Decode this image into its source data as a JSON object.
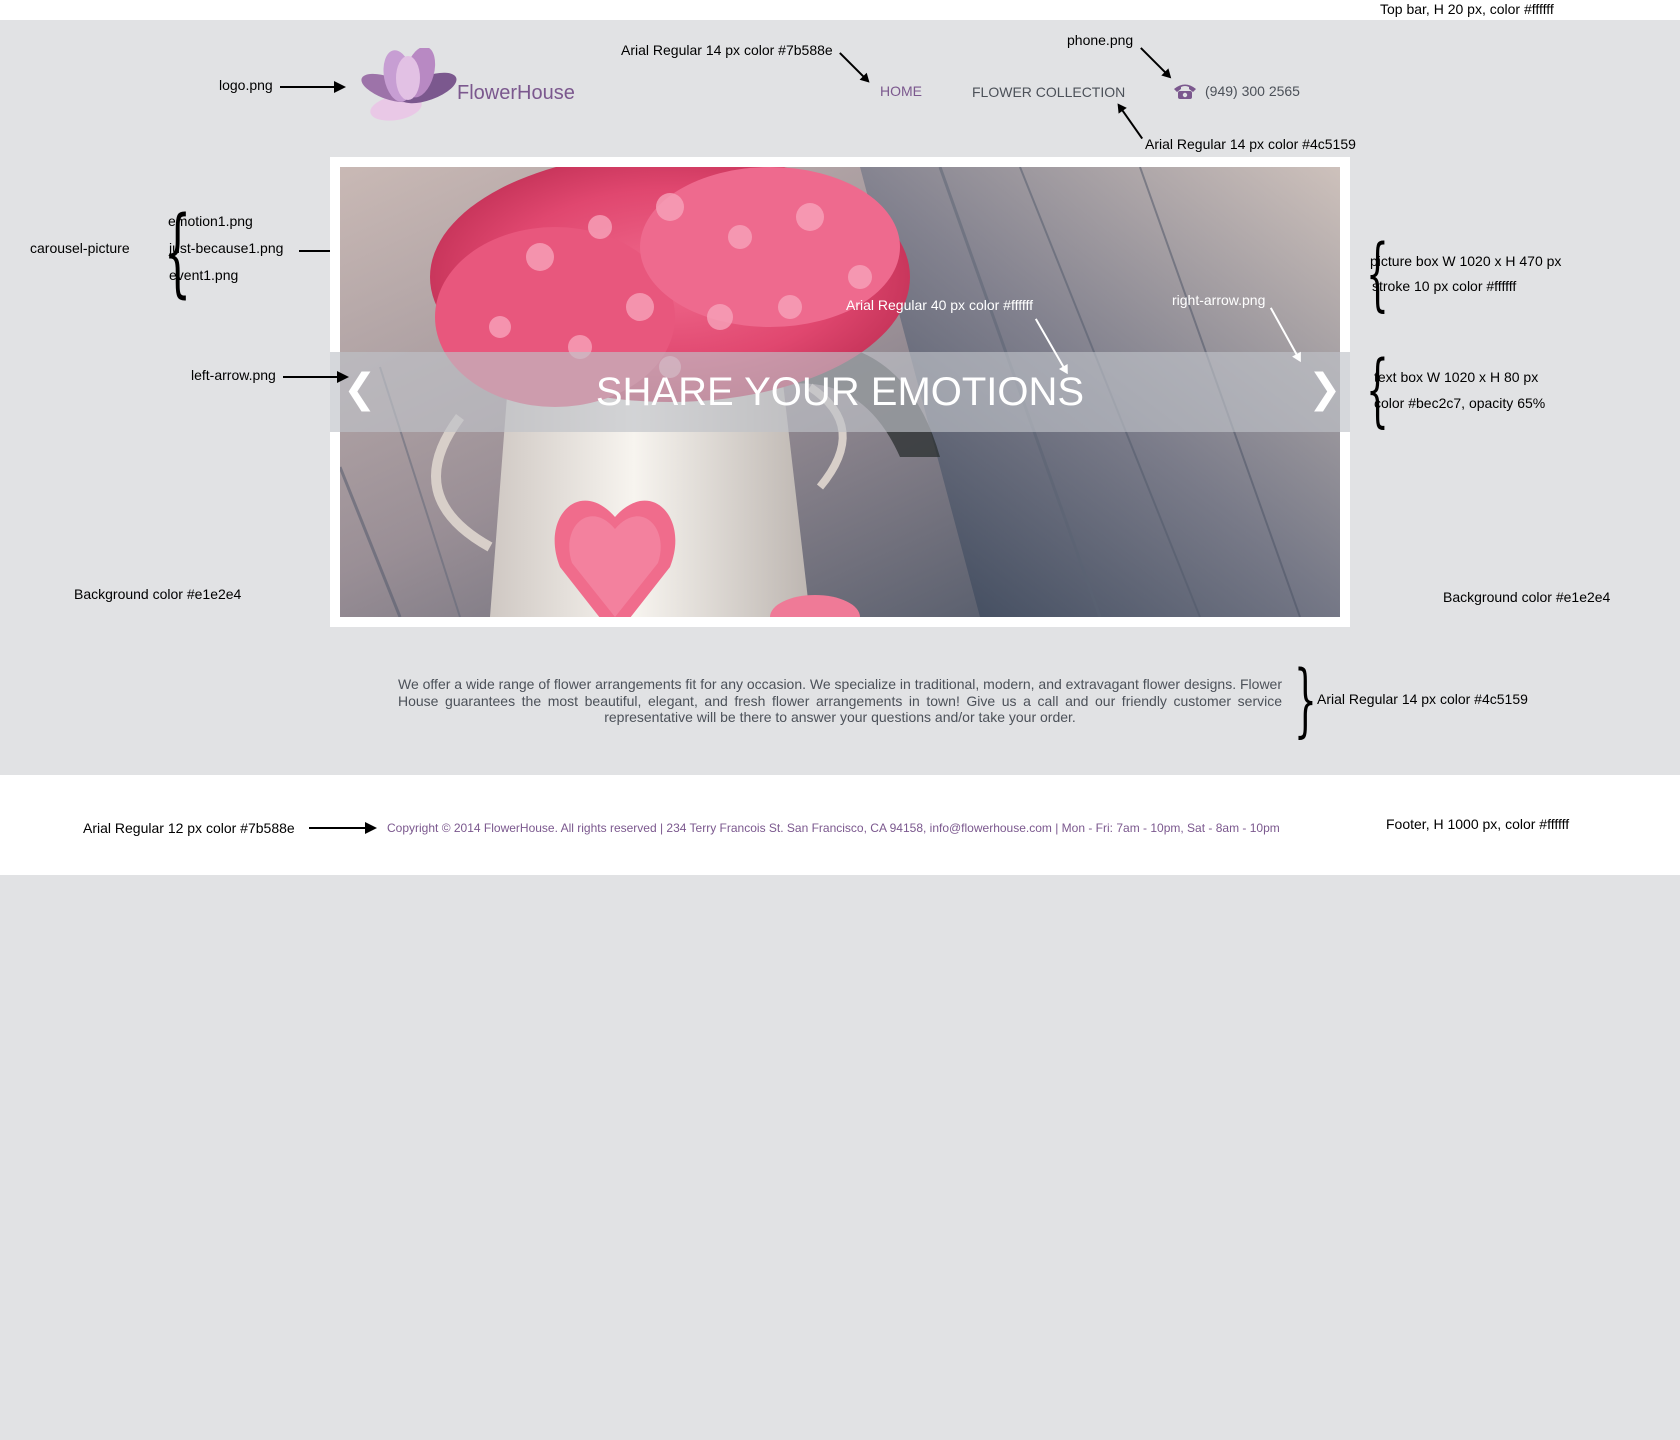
{
  "brand": {
    "name": "FlowerHouse"
  },
  "nav": {
    "home": "HOME",
    "collection": "FLOWER COLLECTION",
    "phone": "(949) 300 2565"
  },
  "hero": {
    "headline": "SHARE YOUR EMOTIONS",
    "left_arrow": "❮",
    "right_arrow": "❯"
  },
  "description": "We offer a wide range of flower arrangements fit for any occasion. We specialize in traditional, modern, and extravagant flower designs. Flower House guarantees the most beautiful, elegant, and fresh flower arrangements in town! Give us a call and our friendly customer service representative will be there to answer your questions and/or take your order.",
  "footer": {
    "text": "Copyright © 2014 FlowerHouse. All rights reserved  |  234 Terry Francois St. San Francisco, CA 94158, info@flowerhouse.com  |  Mon - Fri: 7am - 10pm, Sat - 8am - 10pm"
  },
  "annotations": {
    "top_bar": "Top bar, H 20 px, color #ffffff",
    "logo": "logo.png",
    "nav_home_font": "Arial Regular 14 px color #7b588e",
    "phone_icon": "phone.png",
    "nav_collection_font": "Arial Regular 14 px color #4c5159",
    "carousel_label": "carousel-picture",
    "carousel_files": [
      "emotion1.png",
      "just-because1.png",
      "event1.png"
    ],
    "hero_font": "Arial Regular 40 px color #ffffff",
    "right_arrow": "right-arrow.png",
    "picture_box": [
      "picture box W 1020 x H 470 px",
      "stroke 10 px color #ffffff"
    ],
    "left_arrow": "left-arrow.png",
    "text_box": [
      "text box W 1020 x H 80 px",
      "color #bec2c7, opacity 65%"
    ],
    "bg_left": "Background color #e1e2e4",
    "bg_right": "Background color #e1e2e4",
    "description_font": "Arial Regular 14 px color #4c5159",
    "footer_font": "Arial Regular 12 px color #7b588e",
    "footer_spec": "Footer, H 1000 px, color #ffffff"
  },
  "colors": {
    "accent": "#7b588e",
    "text": "#4c5159",
    "background": "#e1e2e4",
    "white": "#ffffff",
    "text_box": "#bec2c7"
  }
}
